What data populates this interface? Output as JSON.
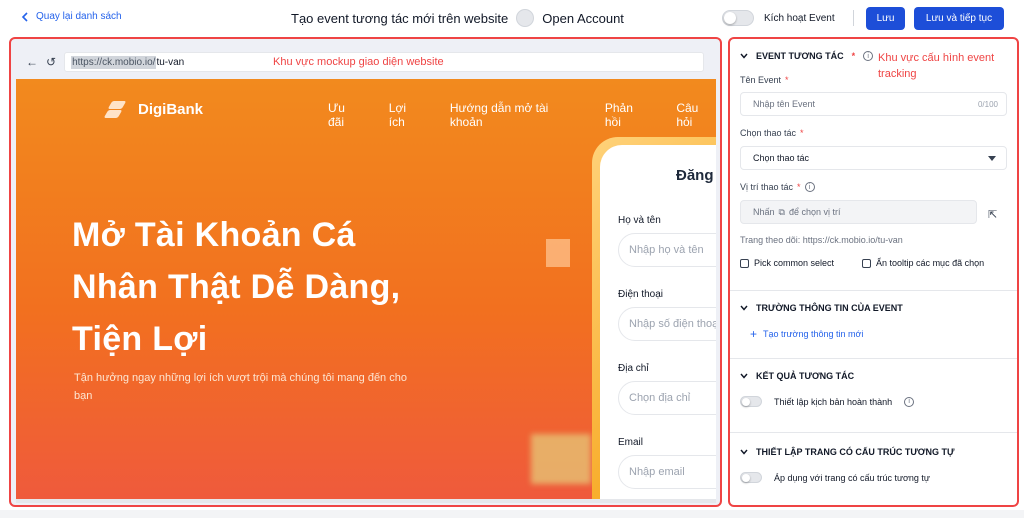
{
  "header": {
    "back_label": "Quay lại danh sách",
    "title": "Tạo event tương tác mới trên website",
    "account": "Open Account",
    "activate_label": "Kích hoạt Event",
    "save_label": "Lưu",
    "save_next_label": "Lưu và tiếp tục"
  },
  "mockup": {
    "url_host": "https://ck.mobio.io/",
    "url_path": "tu-van",
    "annotation": "Khu vực mockup giao diện website",
    "site": {
      "brand": "DigiBank",
      "menu": [
        "Ưu đãi",
        "Lợi ích",
        "Hướng dẫn mở tài khoản",
        "Phản hồi",
        "Câu hỏi"
      ],
      "hero_title": "Mở Tài Khoản Cá Nhân Thật Dễ Dàng, Tiện Lợi",
      "hero_sub": "Tận hưởng ngay những lợi ích vượt trội mà chúng tôi mang đến cho bạn",
      "form_title": "Đăng",
      "fields": [
        {
          "label": "Họ và tên",
          "placeholder": "Nhập họ và tên"
        },
        {
          "label": "Điện thoại",
          "placeholder": "Nhập số điện thoại"
        },
        {
          "label": "Địa chỉ",
          "placeholder": "Chọn địa chỉ"
        },
        {
          "label": "Email",
          "placeholder": "Nhập email"
        }
      ]
    }
  },
  "panel": {
    "annotation": "Khu vực cấu hình event tracking",
    "section1": {
      "title": "EVENT TƯƠNG TÁC",
      "required": "*",
      "event_name_label": "Tên Event",
      "event_name_placeholder": "Nhập tên Event",
      "event_name_count": "0/100",
      "action_label": "Chọn thao tác",
      "action_value": "Chọn thao tác",
      "position_label": "Vị trí thao tác",
      "position_prefix": "Nhấn",
      "position_suffix": "để chọn vị trí",
      "tracking_page": "Trang theo dõi: https://ck.mobio.io/tu-van",
      "check1": "Pick common select",
      "check2": "Ẩn tooltip các mục đã chọn"
    },
    "section2": {
      "title": "TRƯỜNG THÔNG TIN CỦA EVENT",
      "add_label": "Tạo trường thông tin mới"
    },
    "section3": {
      "title": "KẾT QUẢ TƯƠNG TÁC",
      "toggle_label": "Thiết lập kịch bản hoàn thành"
    },
    "section4": {
      "title": "THIẾT LẬP TRANG CÓ CẤU TRÚC TƯƠNG TỰ",
      "toggle_label": "Áp dụng với trang có cấu trúc tương tự"
    }
  },
  "colors": {
    "primary": "#1d4ed8",
    "annotation": "#ef4444",
    "hero_orange": "#f2701f"
  }
}
